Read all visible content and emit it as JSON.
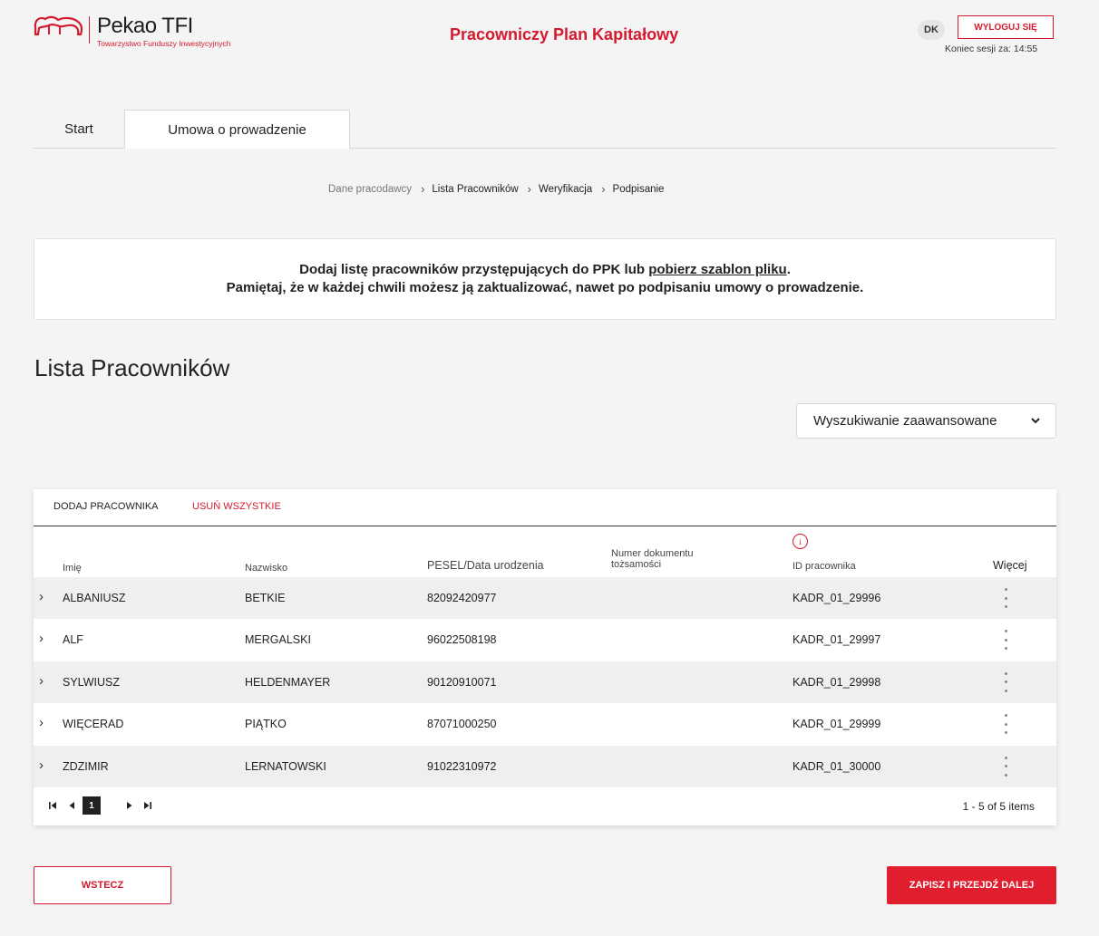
{
  "header": {
    "brand": "Pekao TFI",
    "brand_tagline": "Towarzystwo Funduszy Inwestycyjnych",
    "app_title": "Pracowniczy Plan Kapitałowy",
    "user_initials": "DK",
    "logout_label": "WYLOGUJ SIĘ",
    "session_text": "Koniec sesji za: 14:55"
  },
  "tabs": [
    {
      "label": "Start",
      "active": false
    },
    {
      "label": "Umowa o prowadzenie",
      "active": true
    }
  ],
  "breadcrumb": {
    "steps": [
      "Dane pracodawcy",
      "Lista Pracowników",
      "Weryfikacja",
      "Podpisanie"
    ]
  },
  "info": {
    "line1_before": "Dodaj listę pracowników przystępujących do PPK lub ",
    "line1_link": "pobierz szablon pliku",
    "line1_after": ".",
    "line2": "Pamiętaj, że w każdej chwili możesz ją zaktualizować, nawet po podpisaniu umowy o prowadzenie."
  },
  "section_title": "Lista Pracowników",
  "advanced_search": {
    "label": "Wyszukiwanie zaawansowane"
  },
  "table": {
    "toolbar": {
      "add_label": "DODAJ PRACOWNIKA",
      "delete_all_label": "USUŃ WSZYSTKIE"
    },
    "columns": [
      "Imię",
      "Nazwisko",
      "PESEL/Data urodzenia",
      "Numer dokumentu tożsamości",
      "ID pracownika",
      "Więcej"
    ],
    "columns_doc_line1": "Numer dokumentu",
    "columns_doc_line2": "tożsamości",
    "info_icon_glyph": "i",
    "rows": [
      {
        "imie": "ALBANIUSZ",
        "nazwisko": "BETKIE",
        "pesel": "82092420977",
        "dokument": "",
        "id": "KADR_01_29996"
      },
      {
        "imie": "ALF",
        "nazwisko": "MERGALSKI",
        "pesel": "96022508198",
        "dokument": "",
        "id": "KADR_01_29997"
      },
      {
        "imie": "SYLWIUSZ",
        "nazwisko": "HELDENMAYER",
        "pesel": "90120910071",
        "dokument": "",
        "id": "KADR_01_29998"
      },
      {
        "imie": "WIĘCERAD",
        "nazwisko": "PIĄTKO",
        "pesel": "87071000250",
        "dokument": "",
        "id": "KADR_01_29999"
      },
      {
        "imie": "ZDZIMIR",
        "nazwisko": "LERNATOWSKI",
        "pesel": "91022310972",
        "dokument": "",
        "id": "KADR_01_30000"
      }
    ],
    "pager": {
      "current_page": "1",
      "info": "1 - 5 of 5 items"
    }
  },
  "footer": {
    "back_label": "WSTECZ",
    "next_label": "ZAPISZ I PRZEJDŹ DALEJ"
  },
  "colors": {
    "accent": "#d51a2f",
    "button_primary": "#e01e2d",
    "row_alt": "#efefef",
    "background": "#f4f4f4"
  }
}
